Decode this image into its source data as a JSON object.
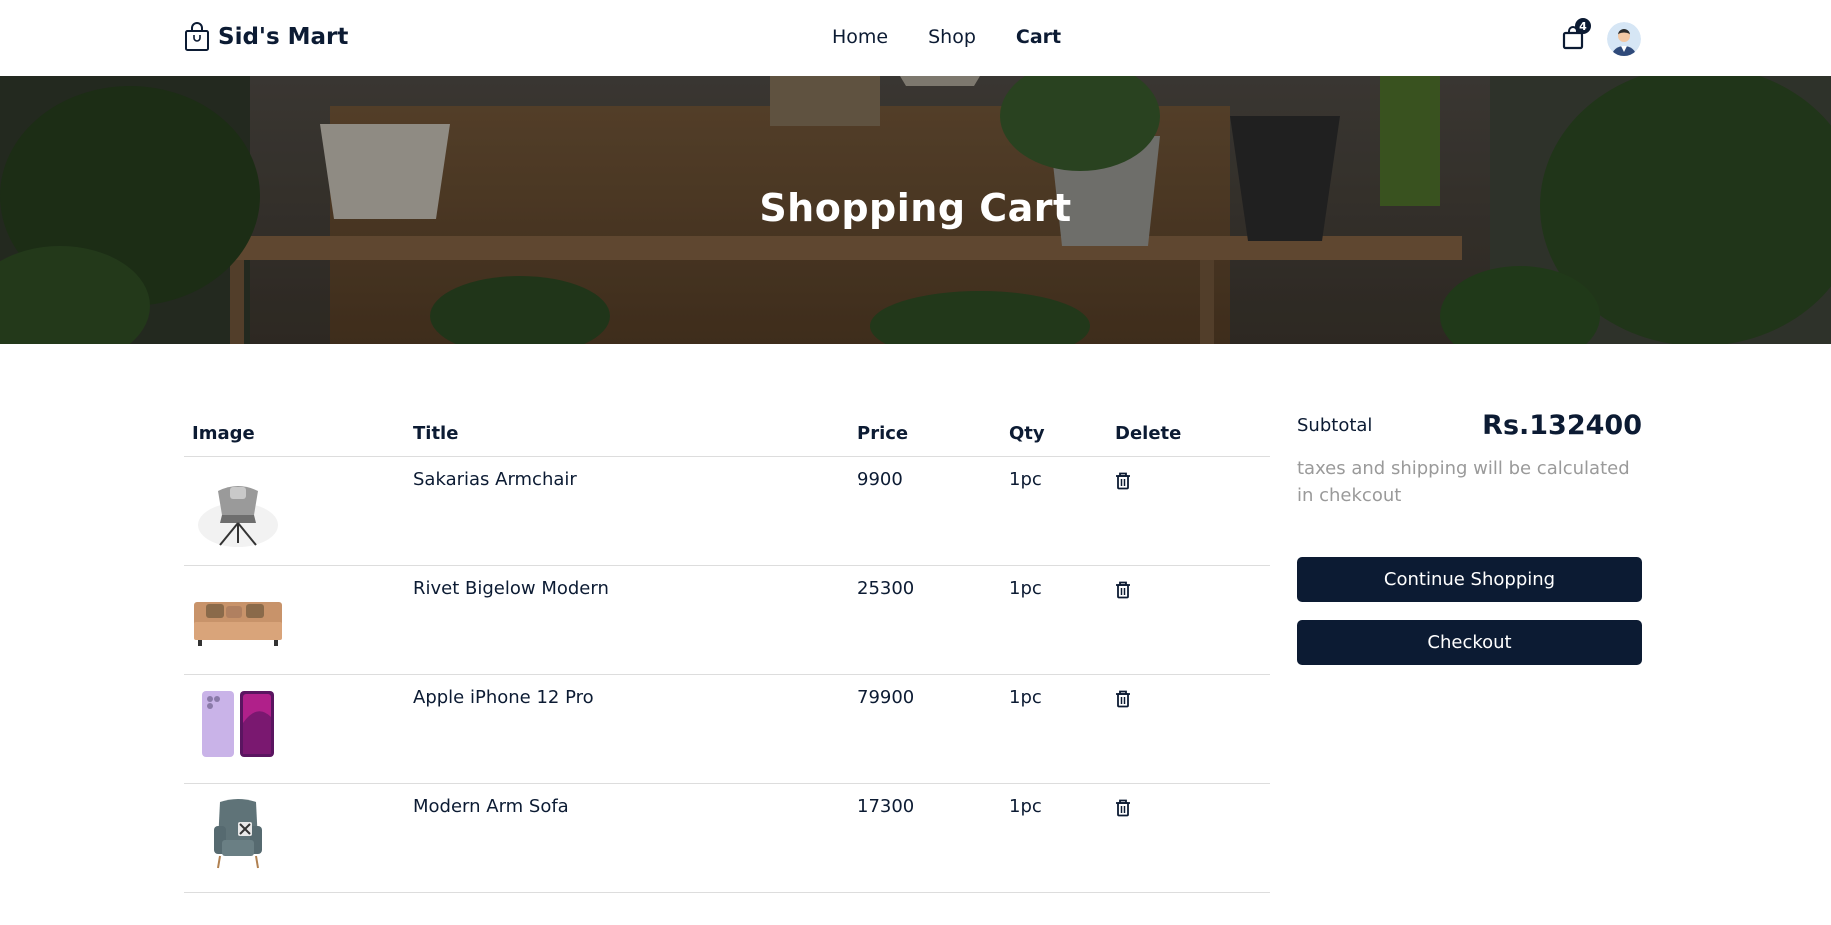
{
  "header": {
    "brand": "Sid's Mart",
    "nav": [
      {
        "label": "Home",
        "active": false
      },
      {
        "label": "Shop",
        "active": false
      },
      {
        "label": "Cart",
        "active": true
      }
    ],
    "cart_count": "4",
    "icons": {
      "brand": "shopping-bag-icon",
      "cart": "cart-bag-icon",
      "avatar": "user-avatar"
    }
  },
  "hero": {
    "title": "Shopping Cart"
  },
  "cart": {
    "headers": {
      "image": "Image",
      "title": "Title",
      "price": "Price",
      "qty": "Qty",
      "delete": "Delete"
    },
    "items": [
      {
        "title": "Sakarias Armchair",
        "price": "9900",
        "qty": "1pc",
        "image": "armchair"
      },
      {
        "title": "Rivet Bigelow Modern",
        "price": "25300",
        "qty": "1pc",
        "image": "sofa"
      },
      {
        "title": "Apple iPhone 12 Pro",
        "price": "79900",
        "qty": "1pc",
        "image": "phone"
      },
      {
        "title": "Modern Arm Sofa",
        "price": "17300",
        "qty": "1pc",
        "image": "wingchair"
      }
    ]
  },
  "summary": {
    "subtotal_label": "Subtotal",
    "subtotal_value": "Rs.132400",
    "note": "taxes and shipping will be calculated in chekcout",
    "continue_label": "Continue Shopping",
    "checkout_label": "Checkout"
  },
  "colors": {
    "primary": "#0c1b33",
    "muted_text": "#9a9a9a",
    "border": "#dddddd"
  }
}
